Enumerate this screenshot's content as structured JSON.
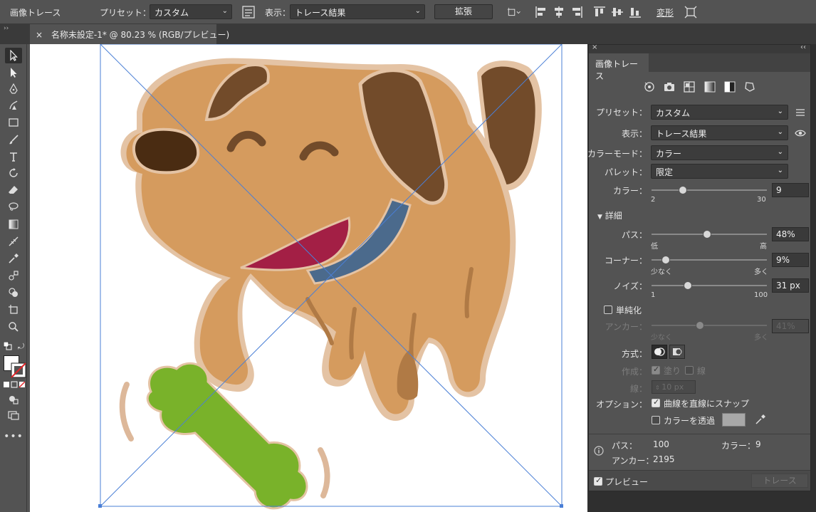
{
  "control_bar": {
    "panel_name": "画像トレース",
    "preset_label": "プリセット：",
    "preset_value": "カスタム",
    "view_label": "表示：",
    "view_value": "トレース結果",
    "expand_label": "拡張",
    "transform_label": "変形"
  },
  "document_tab": {
    "close": "×",
    "title": "名称未設定-1* @ 80.23 % (RGB/プレビュー)"
  },
  "panel": {
    "tab_title": "画像トレース",
    "close": "×",
    "collapse": "‹‹",
    "preset_label": "プリセット：",
    "preset_value": "カスタム",
    "view_label": "表示：",
    "view_value": "トレース結果",
    "color_mode_label": "カラーモード：",
    "color_mode_value": "カラー",
    "palette_label": "パレット：",
    "palette_value": "限定",
    "colors_label": "カラー：",
    "colors_value": "9",
    "colors_min": "2",
    "colors_max": "30",
    "colors_fraction": 0.25,
    "advanced_label": "詳細",
    "paths_label": "パス：",
    "paths_value": "48%",
    "paths_min": "低",
    "paths_max": "高",
    "paths_fraction": 0.48,
    "corners_label": "コーナー：",
    "corners_value": "9%",
    "corners_min": "少なく",
    "corners_max": "多く",
    "corners_fraction": 0.09,
    "noise_label": "ノイズ：",
    "noise_value": "31 px",
    "noise_min": "1",
    "noise_max": "100",
    "noise_fraction": 0.3,
    "simplify_label": "単純化",
    "anchors_label": "アンカー：",
    "anchors_value": "41%",
    "anchors_min": "少なく",
    "anchors_max": "多く",
    "anchors_fraction": 0.41,
    "method_label": "方式：",
    "create_label": "作成：",
    "fills_label": "塗り",
    "strokes_label": "線",
    "stroke_label": "線：",
    "stroke_value": "10 px",
    "options_label": "オプション：",
    "snap_curves_label": "曲線を直線にスナップ",
    "ignore_color_label": "カラーを透過",
    "info_paths_label": "パス：",
    "info_paths_value": "100",
    "info_colors_label": "カラー：",
    "info_colors_value": "9",
    "info_anchors_label": "アンカー：",
    "info_anchors_value": "2195",
    "preview_label": "プレビュー",
    "trace_button": "トレース"
  },
  "colors": {
    "dog_body": "#d59b5e",
    "dog_dark": "#724b2a",
    "nose": "#4a2c12",
    "tongue": "#a31f45",
    "collar": "#4b6a8c",
    "bone": "#79b22a",
    "selection": "#4a7fd6"
  }
}
